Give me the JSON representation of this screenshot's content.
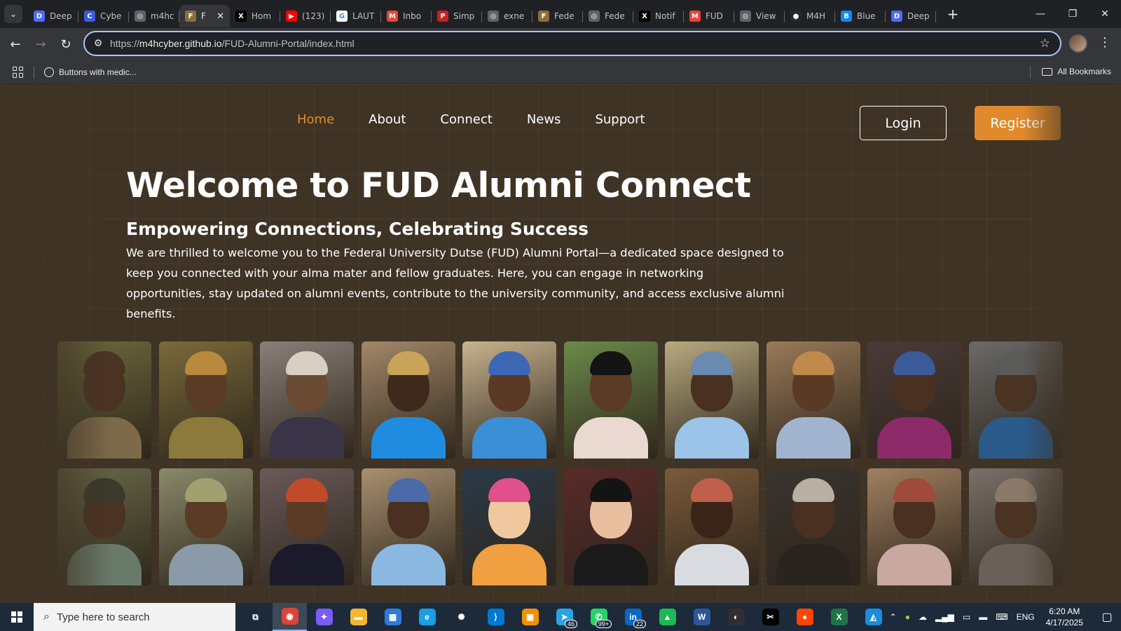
{
  "browser": {
    "tabs": [
      {
        "title": "Deep",
        "favicon": "deepseek-icon",
        "color": "#4d6bfe",
        "glyph": "D"
      },
      {
        "title": "Cybe",
        "favicon": "cyber-icon",
        "color": "#3b5bdb",
        "glyph": "C"
      },
      {
        "title": "m4hc",
        "favicon": "globe-icon",
        "color": "#5f6368",
        "glyph": "◎"
      },
      {
        "title": "F",
        "favicon": "fud-logo-icon",
        "color": "#8a6d3b",
        "glyph": "F",
        "active": true
      },
      {
        "title": "Hom",
        "favicon": "x-icon",
        "color": "#000000",
        "glyph": "X"
      },
      {
        "title": "(123)",
        "favicon": "youtube-icon",
        "color": "#ff0000",
        "glyph": "▶"
      },
      {
        "title": "LAUT",
        "favicon": "google-icon",
        "color": "#ffffff",
        "glyph": "G"
      },
      {
        "title": "Inbo",
        "favicon": "gmail-icon",
        "color": "#ea4335",
        "glyph": "M"
      },
      {
        "title": "Simp",
        "favicon": "pdf-icon",
        "color": "#c5221f",
        "glyph": "P"
      },
      {
        "title": "exne",
        "favicon": "globe-icon",
        "color": "#5f6368",
        "glyph": "◎"
      },
      {
        "title": "Fede",
        "favicon": "fud-logo-icon",
        "color": "#8a6d3b",
        "glyph": "F"
      },
      {
        "title": "Fede",
        "favicon": "globe-icon",
        "color": "#5f6368",
        "glyph": "◎"
      },
      {
        "title": "Notif",
        "favicon": "x-icon",
        "color": "#000000",
        "glyph": "X"
      },
      {
        "title": "FUD",
        "favicon": "gmail-icon",
        "color": "#ea4335",
        "glyph": "M"
      },
      {
        "title": "View",
        "favicon": "globe-icon",
        "color": "#5f6368",
        "glyph": "◎"
      },
      {
        "title": "M4H",
        "favicon": "github-icon",
        "color": "#24292f",
        "glyph": "●"
      },
      {
        "title": "Blue",
        "favicon": "bluesky-icon",
        "color": "#1185fe",
        "glyph": "B"
      },
      {
        "title": "Deep",
        "favicon": "deepseek-icon",
        "color": "#4d6bfe",
        "glyph": "D"
      }
    ],
    "url_scheme": "https://",
    "url_host": "m4hcyber.github.io",
    "url_path": "/FUD-Alumni-Portal/index.html",
    "bookmark": "Buttons with medic...",
    "all_bookmarks": "All Bookmarks"
  },
  "site": {
    "nav": [
      "Home",
      "About",
      "Connect",
      "News",
      "Support"
    ],
    "active_nav": "Home",
    "login": "Login",
    "register": "Register",
    "accent_color": "#e08a2b",
    "hero_title": "Welcome to FUD Alumni Connect",
    "hero_subtitle": "Empowering Connections, Celebrating Success",
    "hero_text": "We are thrilled to welcome you to the Federal University Dutse (FUD) Alumni Portal—a dedicated space designed to keep you connected with your alma mater and fellow graduates. Here, you can engage in networking opportunities, stay updated on alumni events, contribute to the university community, and access exclusive alumni benefits.",
    "gallery_rows": [
      [
        {
          "bg": "#6e6a3c",
          "skin": "#4a3322",
          "cap": "#4a3322",
          "cloth": "#7c6a4a"
        },
        {
          "bg": "#7a6a3a",
          "skin": "#5a3b25",
          "cap": "#b98a3c",
          "cloth": "#8c7a3c"
        },
        {
          "bg": "#8a8078",
          "skin": "#6b4a33",
          "cap": "#d8d0c0",
          "cloth": "#3a3448"
        },
        {
          "bg": "#a28868",
          "skin": "#3e2a1c",
          "cap": "#c9a35a",
          "cloth": "#1f8ce0"
        },
        {
          "bg": "#c8b48e",
          "skin": "#5a3a25",
          "cap": "#3d67b5",
          "cloth": "#3a8fd6"
        },
        {
          "bg": "#6c8a4a",
          "skin": "#5c3b25",
          "cap": "#141414",
          "cloth": "#e9d9d0"
        },
        {
          "bg": "#b8aa80",
          "skin": "#4a3020",
          "cap": "#6a8ab0",
          "cloth": "#9cc3e8"
        },
        {
          "bg": "#9a7a58",
          "skin": "#5a3a24",
          "cap": "#c08a4a",
          "cloth": "#a0b4d0"
        },
        {
          "bg": "#4a3a38",
          "skin": "#4a3020",
          "cap": "#3a5a9a",
          "cloth": "#8c2a6a"
        },
        {
          "bg": "#6a6a68",
          "skin": "#4a3322",
          "cap": "#5a5a58",
          "cloth": "#2a5a8a"
        }
      ],
      [
        {
          "bg": "#6a6a4a",
          "skin": "#4a3322",
          "cap": "#3a3a2a",
          "cloth": "#6a7a6a"
        },
        {
          "bg": "#8a8a6a",
          "skin": "#5a3b25",
          "cap": "#a0a070",
          "cloth": "#8a9aa8"
        },
        {
          "bg": "#6a5a5a",
          "skin": "#5a3b25",
          "cap": "#c04a2a",
          "cloth": "#1a1a2a"
        },
        {
          "bg": "#a89070",
          "skin": "#4a3020",
          "cap": "#4a6aa8",
          "cloth": "#8ab8e0"
        },
        {
          "bg": "#2a3a4a",
          "skin": "#f0c8a0",
          "cap": "#e0508a",
          "cloth": "#f0a040"
        },
        {
          "bg": "#5a2a2a",
          "skin": "#e8c0a0",
          "cap": "#141414",
          "cloth": "#1a1a1a"
        },
        {
          "bg": "#7a5a3a",
          "skin": "#3a2418",
          "cap": "#c0604a",
          "cloth": "#d8dce0"
        },
        {
          "bg": "#3a3430",
          "skin": "#4a3020",
          "cap": "#b8b0a0",
          "cloth": "#2a2420"
        },
        {
          "bg": "#a08060",
          "skin": "#4a3020",
          "cap": "#a04a3a",
          "cloth": "#c8a8a0"
        },
        {
          "bg": "#7a7068",
          "skin": "#4a3322",
          "cap": "#8a7a6a",
          "cloth": "#6a6058"
        }
      ]
    ]
  },
  "taskbar": {
    "search_placeholder": "Type here to search",
    "apps": [
      {
        "name": "task-view-icon",
        "glyph": "⧉",
        "color": "transparent"
      },
      {
        "name": "chrome-icon",
        "glyph": "◉",
        "color": "#db4437",
        "active": true
      },
      {
        "name": "copilot-icon",
        "glyph": "✦",
        "color": "#7a5af8"
      },
      {
        "name": "file-explorer-icon",
        "glyph": "▬",
        "color": "#f2b630"
      },
      {
        "name": "store-icon",
        "glyph": "▦",
        "color": "#2f7bd9"
      },
      {
        "name": "edge-icon",
        "glyph": "e",
        "color": "#1b9de2"
      },
      {
        "name": "chatgpt-icon",
        "glyph": "✺",
        "color": "transparent"
      },
      {
        "name": "vscode-icon",
        "glyph": "⟩",
        "color": "#0078d4"
      },
      {
        "name": "remote-desktop-icon",
        "glyph": "▣",
        "color": "#f29000"
      },
      {
        "name": "telegram-icon",
        "glyph": "➤",
        "color": "#2aa3e0",
        "badge": "46"
      },
      {
        "name": "whatsapp-icon",
        "glyph": "✆",
        "color": "#25d366",
        "badge": "99+"
      },
      {
        "name": "linkedin-icon",
        "glyph": "in",
        "color": "#0a66c2",
        "badge": "22"
      },
      {
        "name": "sheets-icon",
        "glyph": "▲",
        "color": "#1db954"
      },
      {
        "name": "word-icon",
        "glyph": "W",
        "color": "#2b579a"
      },
      {
        "name": "obs-icon",
        "glyph": "◐",
        "color": "#302e31"
      },
      {
        "name": "capcut-icon",
        "glyph": "✂",
        "color": "#000000"
      },
      {
        "name": "reddit-icon",
        "glyph": "●",
        "color": "#ff4500"
      },
      {
        "name": "excel-icon",
        "glyph": "X",
        "color": "#217346"
      },
      {
        "name": "paint-icon",
        "glyph": "◭",
        "color": "#1c8cdc"
      }
    ],
    "language": "ENG",
    "time": "6:20 AM",
    "date": "4/17/2025"
  }
}
